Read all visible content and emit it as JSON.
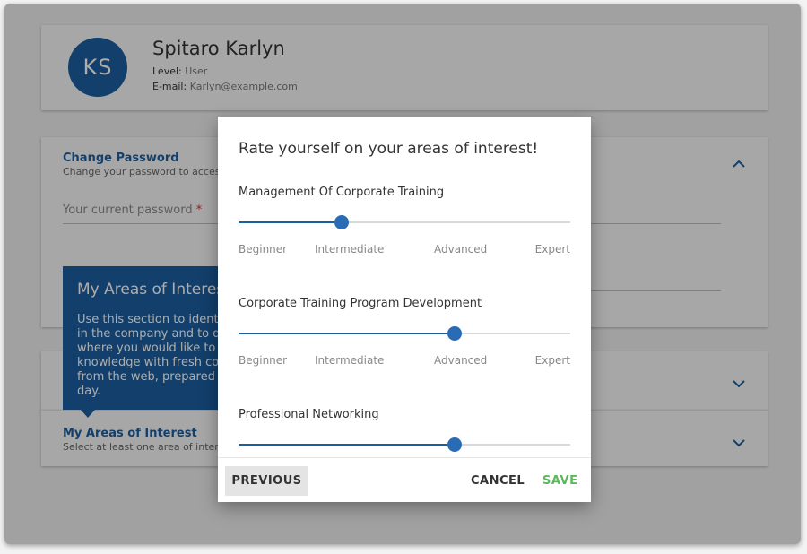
{
  "profile": {
    "initials": "KS",
    "name": "Spitaro Karlyn",
    "level_label": "Level:",
    "level_value": "User",
    "email_label": "E-mail:",
    "email_value": "Karlyn@example.com"
  },
  "change_password": {
    "title": "Change Password",
    "subtitle": "Change your password to access",
    "current_password_placeholder": "Your current password",
    "required_mark": "*",
    "chevron_icon": "chevron-up-icon"
  },
  "tooltip": {
    "title": "My Areas of Interest",
    "body": "Use this section to identify\nin the company and to def\nwhere you would like to in\nknowledge with fresh cont\nfrom the web, prepared fo\nday."
  },
  "section2": {
    "chevron_icon": "chevron-down-icon"
  },
  "areas_of_interest": {
    "title": "My Areas of Interest",
    "subtitle": "Select at least one area of intere",
    "chevron_icon": "chevron-down-icon"
  },
  "dialog": {
    "title": "Rate yourself on your areas of interest!",
    "level_labels": [
      "Beginner",
      "Intermediate",
      "Advanced",
      "Expert"
    ],
    "skills": [
      {
        "name": "Management Of Corporate Training",
        "value": 0.31
      },
      {
        "name": "Corporate Training Program Development",
        "value": 0.65
      },
      {
        "name": "Professional Networking",
        "value": 0.65
      }
    ],
    "buttons": {
      "previous": "PREVIOUS",
      "cancel": "CANCEL",
      "save": "SAVE"
    }
  },
  "colors": {
    "accent": "#1b5e9e",
    "slider_thumb": "#2a6bb5",
    "save": "#5cb85c",
    "required": "#d0312d"
  }
}
